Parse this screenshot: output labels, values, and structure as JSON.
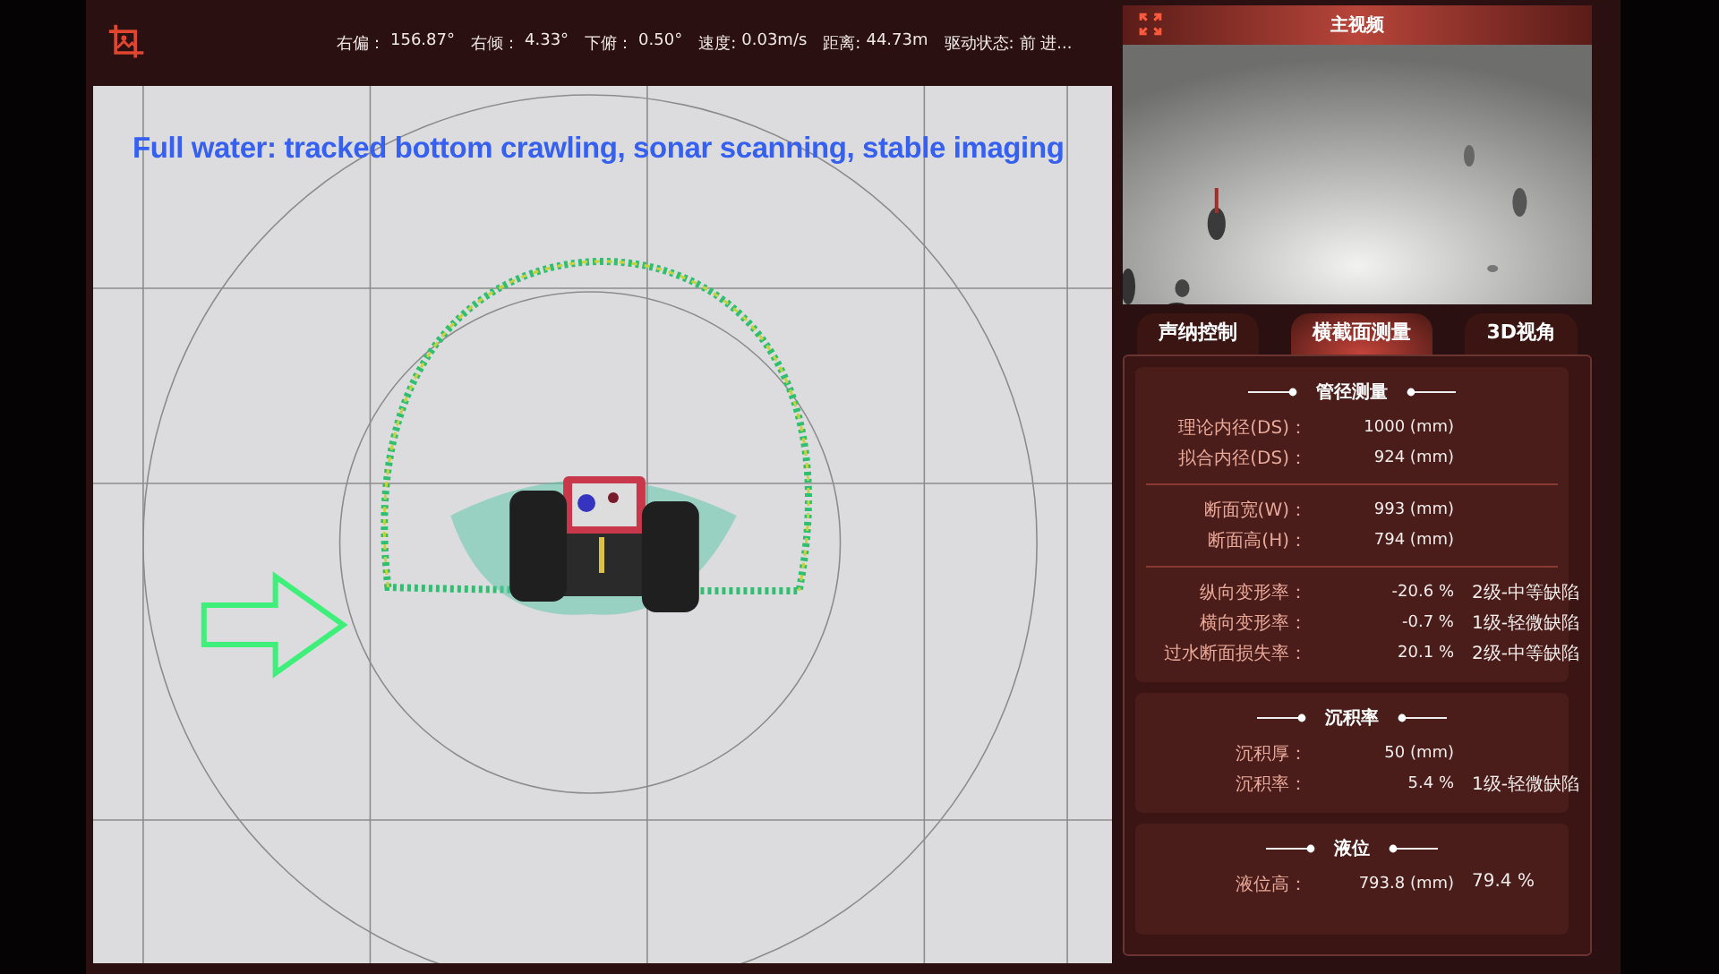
{
  "header": {
    "stats": [
      {
        "label": "右偏：",
        "value": "156.87°"
      },
      {
        "label": "右倾：",
        "value": "4.33°"
      },
      {
        "label": "下俯：",
        "value": "0.50°"
      },
      {
        "label": "速度:",
        "value": "0.03m/s"
      },
      {
        "label": "距离:",
        "value": "44.73m"
      },
      {
        "label": "驱动状态:",
        "value": "前 进..."
      }
    ]
  },
  "view": {
    "caption": "Full water: tracked bottom crawling, sonar scanning, stable imaging"
  },
  "video": {
    "title": "主视频",
    "kind": "picture"
  },
  "tabs": [
    {
      "label": "声纳控制",
      "selected": false
    },
    {
      "label": "横截面测量",
      "selected": true
    },
    {
      "label": "3D视角",
      "selected": false
    }
  ],
  "sections": [
    {
      "title": "管径测量",
      "groups": [
        [
          {
            "label": "理论内径(DS)：",
            "value": "1000 (mm)"
          },
          {
            "label": "拟合内径(DS)：",
            "value": "924 (mm)"
          }
        ],
        [
          {
            "label": "断面宽(W)：",
            "value": "993 (mm)"
          },
          {
            "label": "断面高(H)：",
            "value": "794 (mm)"
          }
        ],
        [
          {
            "label": "纵向变形率：",
            "value": "-20.6 %",
            "grade": "2级-中等缺陷"
          },
          {
            "label": "横向变形率：",
            "value": "-0.7 %",
            "grade": "1级-轻微缺陷"
          },
          {
            "label": "过水断面损失率：",
            "value": "20.1 %",
            "grade": "2级-中等缺陷"
          }
        ]
      ]
    },
    {
      "title": "沉积率",
      "groups": [
        [
          {
            "label": "沉积厚：",
            "value": "50 (mm)"
          },
          {
            "label": "沉积率：",
            "value": "5.4 %",
            "grade": "1级-轻微缺陷"
          }
        ]
      ]
    },
    {
      "title": "液位",
      "groups": [
        [
          {
            "label": "液位高：",
            "value": "793.8 (mm)",
            "grade": "79.4 %"
          }
        ]
      ]
    }
  ]
}
